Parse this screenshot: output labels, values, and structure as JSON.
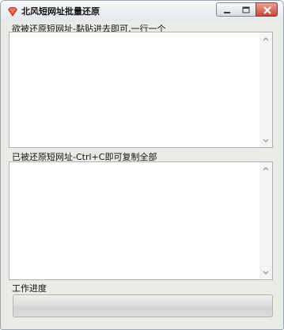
{
  "window": {
    "title": "北风短网址批量还原",
    "icon": "red-diamond-icon",
    "controls": [
      "minimize-icon",
      "maximize-icon",
      "close-icon"
    ]
  },
  "input_section": {
    "label": "欲被还原短网址-黏贴进去即可,一行一个",
    "value": ""
  },
  "output_section": {
    "label": "已被还原短网址-Ctrl+C即可复制全部",
    "value": ""
  },
  "progress_section": {
    "label": "工作进度",
    "progress_fraction": 0
  },
  "colors": {
    "accent": "#d03a2c",
    "close_button": "#c8453a"
  }
}
